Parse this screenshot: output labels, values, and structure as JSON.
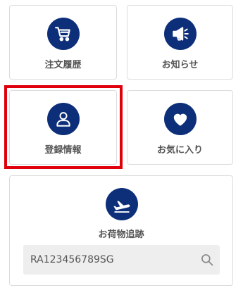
{
  "tiles": [
    {
      "label": "注文履歴",
      "icon": "cart-icon"
    },
    {
      "label": "お知らせ",
      "icon": "megaphone-icon"
    },
    {
      "label": "登録情報",
      "icon": "user-icon"
    },
    {
      "label": "お気に入り",
      "icon": "heart-icon"
    }
  ],
  "tracking": {
    "label": "お荷物追跡",
    "icon": "airplane-icon",
    "value": "RA123456789SG",
    "search_icon": "search-icon"
  },
  "colors": {
    "icon_background": "#0d2f7a",
    "highlight": "#e0000b",
    "label_text": "#555555",
    "search_background": "#eeeeee"
  }
}
